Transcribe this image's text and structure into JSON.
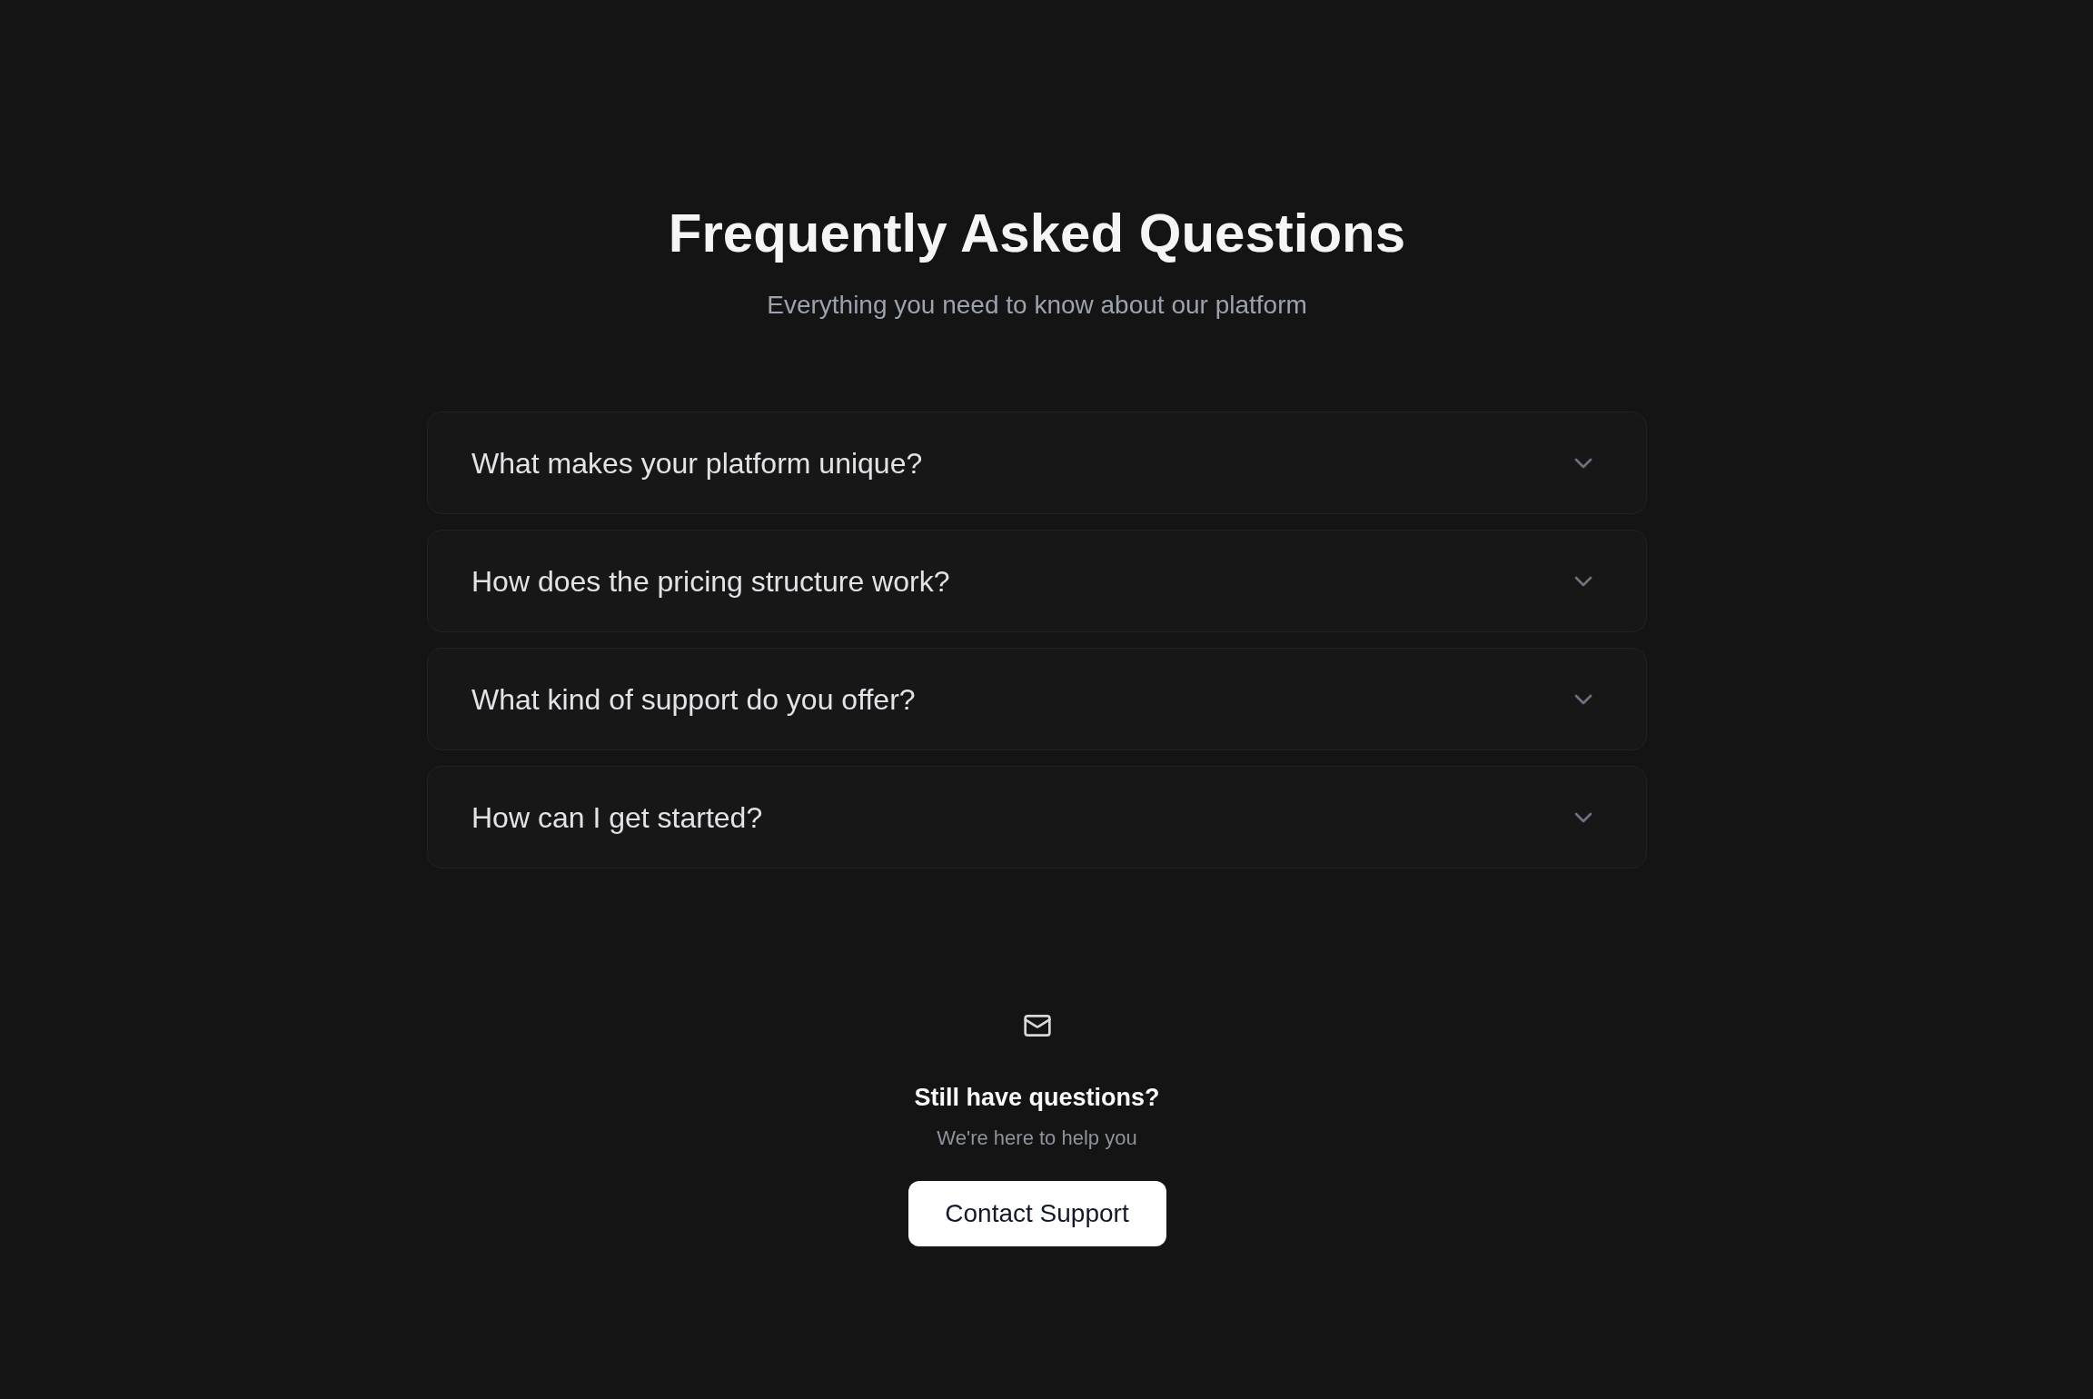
{
  "header": {
    "title": "Frequently Asked Questions",
    "subtitle": "Everything you need to know about our platform"
  },
  "faq": [
    {
      "question": "What makes your platform unique?",
      "expanded": false
    },
    {
      "question": "How does the pricing structure work?",
      "expanded": false
    },
    {
      "question": "What kind of support do you offer?",
      "expanded": false
    },
    {
      "question": "How can I get started?",
      "expanded": false
    }
  ],
  "contact": {
    "heading": "Still have questions?",
    "text": "We're here to help you",
    "button": "Contact Support"
  }
}
